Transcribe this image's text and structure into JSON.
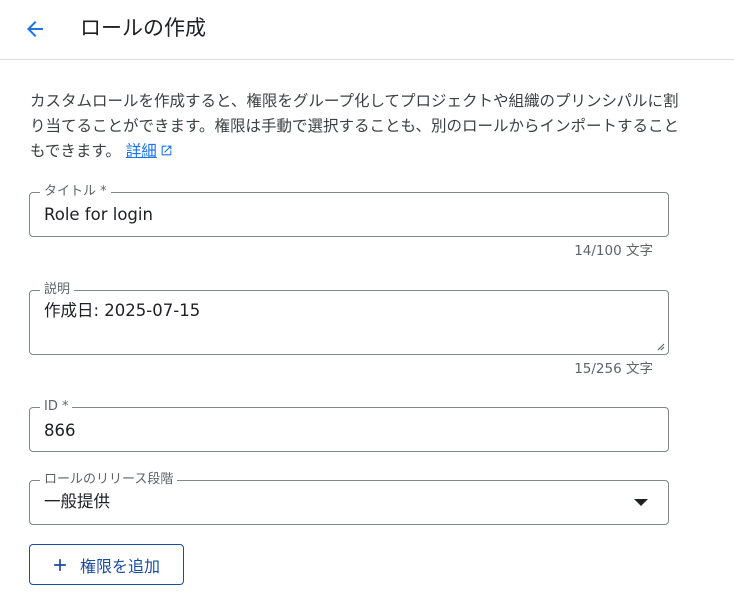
{
  "header": {
    "title": "ロールの作成"
  },
  "intro": {
    "text": "カスタムロールを作成すると、権限をグループ化してプロジェクトや組織のプリンシパルに割り当てることができます。権限は手動で選択することも、別のロールからインポートすることもできます。",
    "learn_more": "詳細"
  },
  "form": {
    "title": {
      "label": "タイトル *",
      "value": "Role for login",
      "counter": "14/100 文字"
    },
    "description": {
      "label": "説明",
      "value": "作成日: 2025-07-15",
      "counter": "15/256 文字"
    },
    "id": {
      "label": "ID *",
      "value": "866"
    },
    "stage": {
      "label": "ロールのリリース段階",
      "value": "一般提供"
    }
  },
  "actions": {
    "add_permissions": "権限を追加"
  },
  "colors": {
    "accent": "#1a73e8",
    "button": "#1a4b9c",
    "border": "#80868b"
  },
  "icons": {
    "back": "arrow-left-icon",
    "external": "open-in-new-icon",
    "add": "plus-icon",
    "dropdown": "caret-down-icon"
  }
}
